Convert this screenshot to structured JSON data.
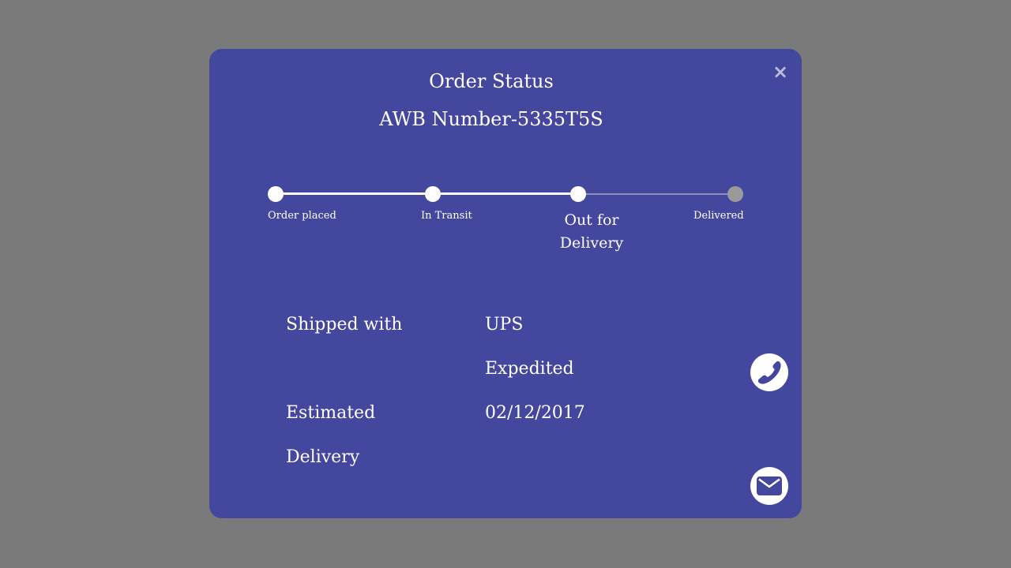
{
  "modal": {
    "close_label": "×",
    "title": "Order Status",
    "awb": {
      "prefix": "AWB Number",
      "separator": "-",
      "number": "5335T5S"
    }
  },
  "steps": [
    {
      "label": "Order placed",
      "status": "done"
    },
    {
      "label": "In Transit",
      "status": "done"
    },
    {
      "label": "Out for Delivery",
      "status": "current"
    },
    {
      "label": "Delivered",
      "status": "pending"
    }
  ],
  "details": {
    "shipped_with_label": "Shipped with",
    "carrier": "UPS",
    "service": "Expedited",
    "estimated_label_line1": "Estimated",
    "estimated_label_line2": "Delivery",
    "estimated_date": "02/12/2017"
  },
  "actions": {
    "call_icon": "phone-icon",
    "mail_icon": "envelope-icon"
  },
  "colors": {
    "backdrop": "#7a7a7a",
    "modal_bg": "#43479e",
    "completed": "#ffffff",
    "pending_track": "#8f8fb4",
    "pending_dot": "#9a9a9a",
    "close_icon": "#b9bbdf"
  }
}
